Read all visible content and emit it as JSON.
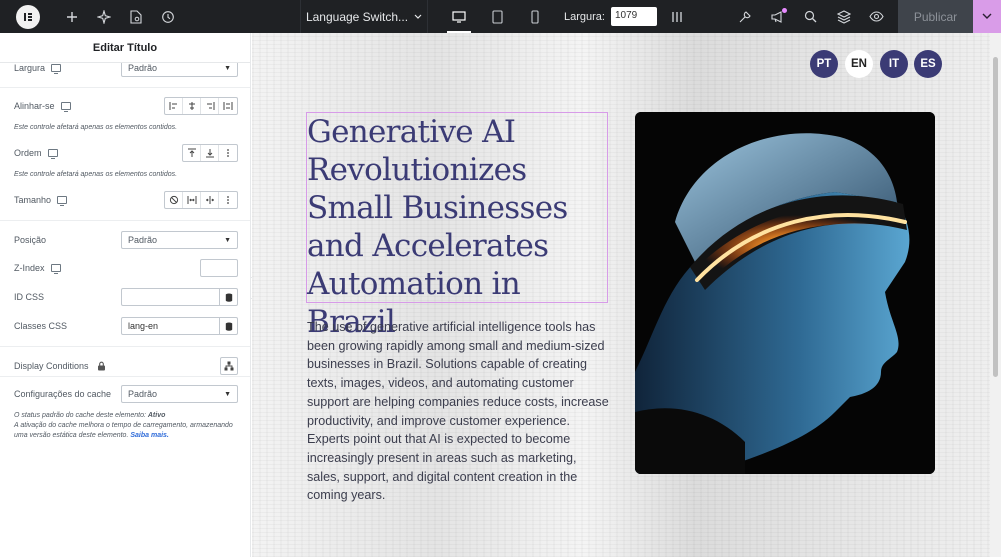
{
  "topbar": {
    "doc_title": "Language Switch...",
    "width_label": "Largura:",
    "width_value": "1079",
    "publish_label": "Publicar"
  },
  "panel": {
    "title": "Editar Título",
    "width_label": "Largura",
    "width_value": "Padrão",
    "align_self_label": "Alinhar-se",
    "align_note": "Este controle afetará apenas os elementos contidos.",
    "order_label": "Ordem",
    "order_note": "Este controle afetará apenas os elementos contidos.",
    "size_label": "Tamanho",
    "position_label": "Posição",
    "position_value": "Padrão",
    "zindex_label": "Z-Index",
    "css_id_label": "ID CSS",
    "css_classes_label": "Classes CSS",
    "css_classes_value": "lang-en",
    "display_conditions_label": "Display Conditions",
    "cache_label": "Configurações do cache",
    "cache_value": "Padrão",
    "cache_note_1": "O status padrão do cache deste elemento:",
    "cache_note_status": "Ativo",
    "cache_note_2": "A ativação do cache melhora o tempo de carregamento, armazenando uma versão estática deste elemento.",
    "cache_note_link": "Saiba mais."
  },
  "canvas": {
    "languages": [
      "PT",
      "EN",
      "IT",
      "ES"
    ],
    "active_language": "EN",
    "headline": "Generative AI Revolutionizes Small Businesses and Accelerates Automation in Brazil",
    "body": "The use of generative artificial intelligence tools has been growing rapidly among small and medium-sized businesses in Brazil. Solutions capable of creating texts, images, videos, and automating customer support are helping companies reduce costs, increase productivity, and improve customer experience. Experts point out that AI is expected to become increasingly present in areas such as marketing, sales, support, and digital content creation in the coming years."
  },
  "colors": {
    "topbar_bg": "#1f2124",
    "accent_pink": "#d99ce8",
    "heading_navy": "#3b3b75",
    "lang_button": "#3b3b75"
  }
}
